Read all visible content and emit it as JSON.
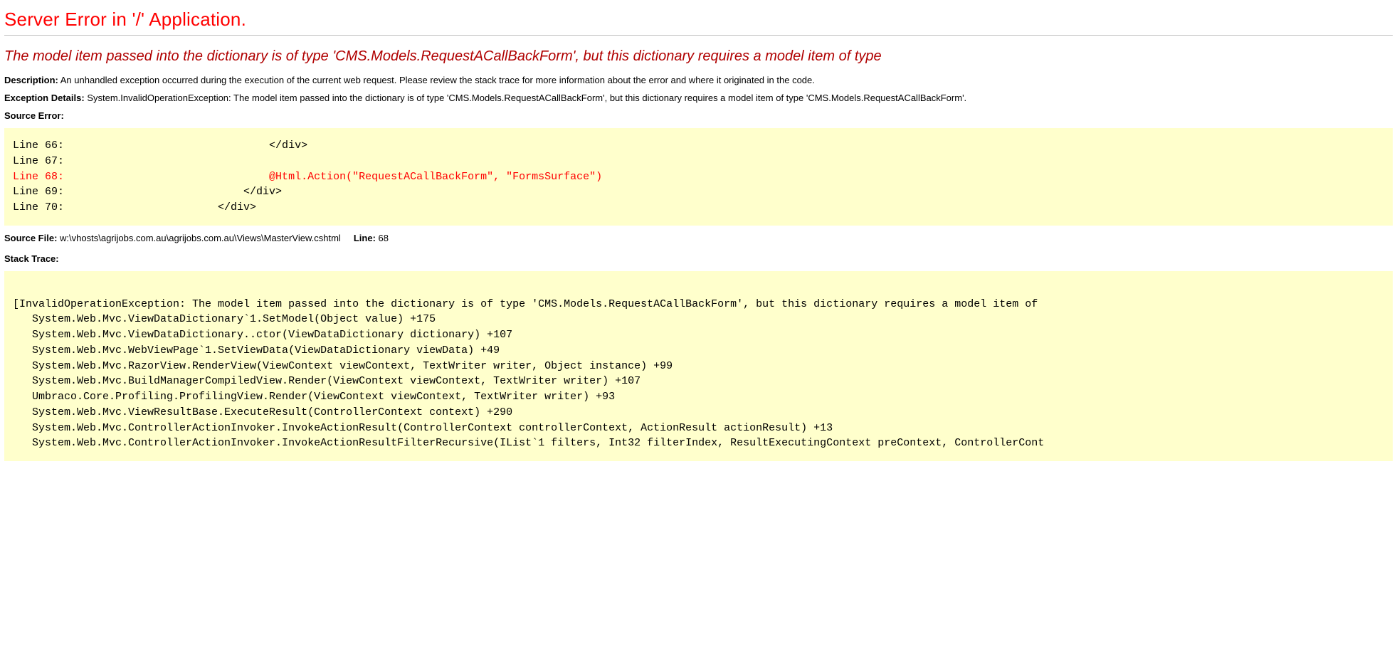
{
  "title": "Server Error in '/' Application.",
  "error_heading": "The model item passed into the dictionary is of type 'CMS.Models.RequestACallBackForm', but this dictionary requires a model item of type",
  "description_label": "Description:",
  "description_text": "An unhandled exception occurred during the execution of the current web request. Please review the stack trace for more information about the error and where it originated in the code.",
  "exception_label": "Exception Details:",
  "exception_text": "System.InvalidOperationException: The model item passed into the dictionary is of type 'CMS.Models.RequestACallBackForm', but this dictionary requires a model item of type 'CMS.Models.RequestACallBackForm'.",
  "source_error_label": "Source Error:",
  "source_lines": {
    "l66": "Line 66:                                </div>",
    "l67": "Line 67:",
    "l68": "Line 68:                                @Html.Action(\"RequestACallBackForm\", \"FormsSurface\")",
    "l69": "Line 69:                            </div>",
    "l70": "Line 70:                        </div>"
  },
  "source_file_label": "Source File:",
  "source_file_value": "w:\\vhosts\\agrijobs.com.au\\agrijobs.com.au\\Views\\MasterView.cshtml",
  "line_label": "Line:",
  "line_value": "68",
  "stack_trace_label": "Stack Trace:",
  "stack_trace": "\n[InvalidOperationException: The model item passed into the dictionary is of type 'CMS.Models.RequestACallBackForm', but this dictionary requires a model item of\n   System.Web.Mvc.ViewDataDictionary`1.SetModel(Object value) +175\n   System.Web.Mvc.ViewDataDictionary..ctor(ViewDataDictionary dictionary) +107\n   System.Web.Mvc.WebViewPage`1.SetViewData(ViewDataDictionary viewData) +49\n   System.Web.Mvc.RazorView.RenderView(ViewContext viewContext, TextWriter writer, Object instance) +99\n   System.Web.Mvc.BuildManagerCompiledView.Render(ViewContext viewContext, TextWriter writer) +107\n   Umbraco.Core.Profiling.ProfilingView.Render(ViewContext viewContext, TextWriter writer) +93\n   System.Web.Mvc.ViewResultBase.ExecuteResult(ControllerContext context) +290\n   System.Web.Mvc.ControllerActionInvoker.InvokeActionResult(ControllerContext controllerContext, ActionResult actionResult) +13\n   System.Web.Mvc.ControllerActionInvoker.InvokeActionResultFilterRecursive(IList`1 filters, Int32 filterIndex, ResultExecutingContext preContext, ControllerCont"
}
